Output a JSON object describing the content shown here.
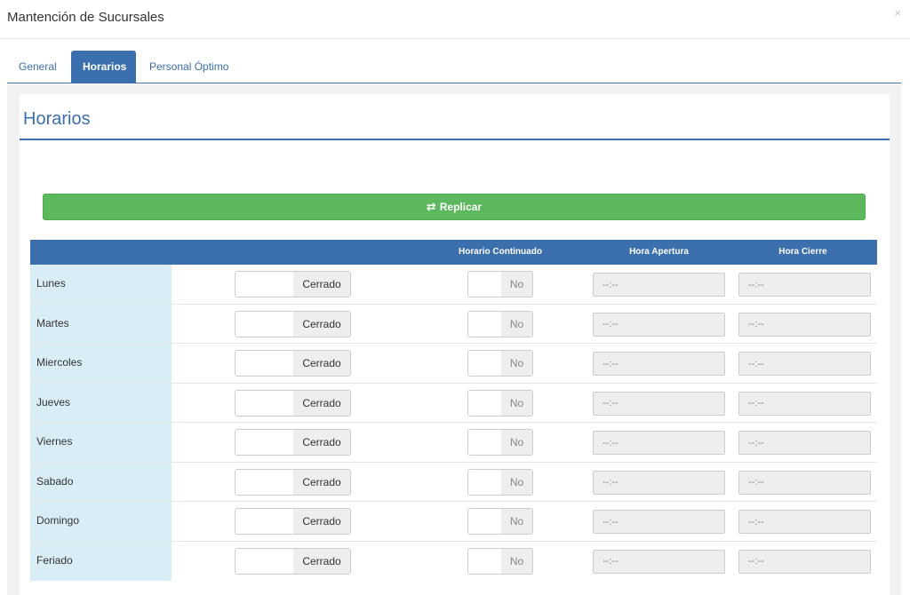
{
  "modal": {
    "title": "Mantención de Sucursales",
    "close_symbol": "×"
  },
  "tabs": [
    {
      "label": "General",
      "active": false
    },
    {
      "label": "Horarios",
      "active": true
    },
    {
      "label": "Personal Óptimo",
      "active": false
    }
  ],
  "section": {
    "title": "Horarios"
  },
  "replicar": {
    "label": "Replicar",
    "icon": "exchange-icon",
    "icon_glyph": "⇄",
    "color": "#5cb85c"
  },
  "table": {
    "headers": {
      "day": "",
      "status": "",
      "continuous": "Horario Continuado",
      "open": "Hora Apertura",
      "close": "Hora Cierre"
    },
    "rows": [
      {
        "day": "Lunes",
        "status": "Cerrado",
        "continuous": "No",
        "open_placeholder": "--:--",
        "close_placeholder": "--:--"
      },
      {
        "day": "Martes",
        "status": "Cerrado",
        "continuous": "No",
        "open_placeholder": "--:--",
        "close_placeholder": "--:--"
      },
      {
        "day": "Miercoles",
        "status": "Cerrado",
        "continuous": "No",
        "open_placeholder": "--:--",
        "close_placeholder": "--:--"
      },
      {
        "day": "Jueves",
        "status": "Cerrado",
        "continuous": "No",
        "open_placeholder": "--:--",
        "close_placeholder": "--:--"
      },
      {
        "day": "Viernes",
        "status": "Cerrado",
        "continuous": "No",
        "open_placeholder": "--:--",
        "close_placeholder": "--:--"
      },
      {
        "day": "Sabado",
        "status": "Cerrado",
        "continuous": "No",
        "open_placeholder": "--:--",
        "close_placeholder": "--:--"
      },
      {
        "day": "Domingo",
        "status": "Cerrado",
        "continuous": "No",
        "open_placeholder": "--:--",
        "close_placeholder": "--:--"
      },
      {
        "day": "Feriado",
        "status": "Cerrado",
        "continuous": "No",
        "open_placeholder": "--:--",
        "close_placeholder": "--:--"
      }
    ]
  },
  "colors": {
    "primary": "#3b6fae",
    "success": "#5cb85c",
    "day_cell": "#d9edf7",
    "disabled_input": "#eeeeee"
  }
}
